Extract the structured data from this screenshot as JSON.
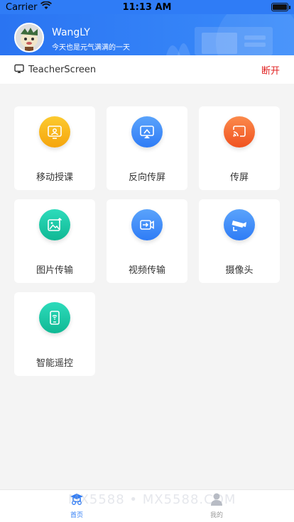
{
  "status_bar": {
    "carrier": "Carrier",
    "time": "11:13 AM"
  },
  "profile": {
    "name": "WangLY",
    "motto": "今天也是元气满满的一天"
  },
  "connection": {
    "device": "TeacherScreen",
    "action": "断开"
  },
  "features": [
    {
      "label": "移动授课",
      "icon": "mobile-teaching-icon",
      "color": "#f8b81a"
    },
    {
      "label": "反向传屏",
      "icon": "reverse-cast-icon",
      "color": "#3d8ef7"
    },
    {
      "label": "传屏",
      "icon": "screen-cast-icon",
      "color": "#f36d32"
    },
    {
      "label": "图片传输",
      "icon": "image-transfer-icon",
      "color": "#16c7a7"
    },
    {
      "label": "视频传输",
      "icon": "video-transfer-icon",
      "color": "#3d8ef7"
    },
    {
      "label": "摄像头",
      "icon": "camera-icon",
      "color": "#3d8ef7"
    },
    {
      "label": "智能遥控",
      "icon": "smart-remote-icon",
      "color": "#16c7a7"
    }
  ],
  "tabs": [
    {
      "label": "首页",
      "icon": "home-icon",
      "active": true
    },
    {
      "label": "我的",
      "icon": "profile-icon",
      "active": false
    }
  ],
  "watermark": "MX5588 • MX5588.COM",
  "colors": {
    "brand": "#2f7cf6",
    "danger": "#e02020",
    "tab_active": "#2f7cf6",
    "tab_inactive": "#b0b0b0"
  }
}
